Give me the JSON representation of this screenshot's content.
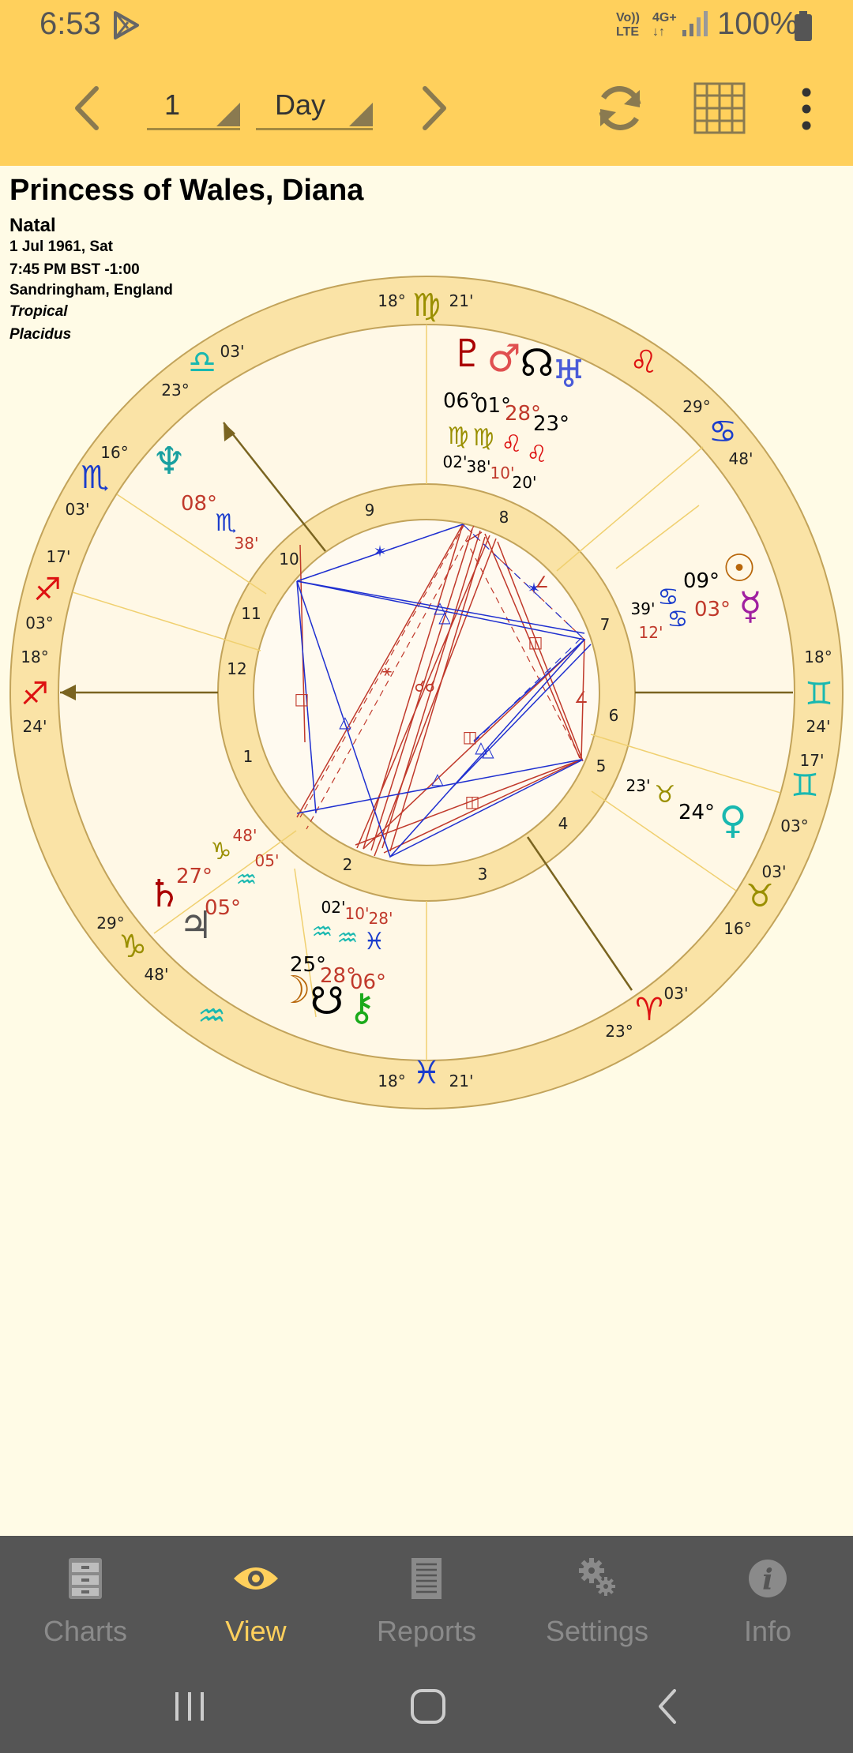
{
  "status": {
    "time": "6:53",
    "net_top": "Vo))",
    "net_bottom": "LTE",
    "net2_top": "4G+",
    "net2_bottom": "↓↑",
    "battery": "100%"
  },
  "toolbar": {
    "step_value": "1",
    "unit_value": "Day"
  },
  "chart": {
    "name": "Princess of Wales, Diana",
    "type": "Natal",
    "date": "1 Jul 1961, Sat",
    "time": "7:45 PM BST -1:00",
    "place": "Sandringham, England",
    "zodiac": "Tropical",
    "houses": "Placidus"
  },
  "wheel": {
    "outer_signs": [
      {
        "sign": "♍",
        "deg": "18°",
        "min": "21'",
        "color": "#9a8f00"
      },
      {
        "sign": "♌",
        "color": "#d11"
      },
      {
        "sign": "♋",
        "deg": "29°",
        "min": "48'",
        "color": "#1a3ccc"
      },
      {
        "sign": "♊",
        "deg": "18°",
        "min": "24'",
        "color": "#19b8b0"
      },
      {
        "sign": "♊",
        "deg": "17'",
        "min": "03°",
        "color": "#19b8b0"
      },
      {
        "sign": "♉",
        "deg": "03'",
        "min": "16°",
        "color": "#9a8f00"
      },
      {
        "sign": "♈",
        "deg": "03'",
        "min": "23°",
        "color": "#d11"
      },
      {
        "sign": "♓",
        "deg": "18°",
        "min": "21'",
        "color": "#1a3ccc"
      },
      {
        "sign": "♒",
        "color": "#19b8b0"
      },
      {
        "sign": "♑",
        "deg": "29°",
        "min": "48'",
        "color": "#9a8f00"
      },
      {
        "sign": "♐",
        "deg": "18°",
        "min": "24'",
        "color": "#d11"
      },
      {
        "sign": "♐",
        "deg": "17'",
        "min": "03°",
        "color": "#d11"
      },
      {
        "sign": "♏",
        "deg": "03'",
        "min": "16°",
        "color": "#1a3ccc"
      },
      {
        "sign": "♎",
        "deg": "03'",
        "min": "23°",
        "color": "#19b8b0"
      }
    ],
    "house_numbers": [
      "1",
      "2",
      "3",
      "4",
      "5",
      "6",
      "7",
      "8",
      "9",
      "10",
      "11",
      "12"
    ],
    "planets": [
      {
        "glyph": "♇",
        "deg": "06°",
        "min": "02'",
        "sign": "♍",
        "color": "#a00"
      },
      {
        "glyph": "♂",
        "deg": "01°",
        "min": "38'",
        "sign": "♍",
        "color": "#e05050"
      },
      {
        "glyph": "☊",
        "deg": "28°",
        "min": "10'",
        "sign": "♌",
        "color": "#000"
      },
      {
        "glyph": "♅",
        "deg": "23°",
        "min": "20'",
        "sign": "♌",
        "color": "#4a5bd8"
      },
      {
        "glyph": "☉",
        "deg": "09°",
        "min": "39'",
        "sign": "♋",
        "color": "#b8660a"
      },
      {
        "glyph": "☿",
        "deg": "03°",
        "min": "12'",
        "sign": "♋",
        "color": "#a020a0"
      },
      {
        "glyph": "♀",
        "deg": "24°",
        "min": "23'",
        "sign": "♉",
        "color": "#19b8b0"
      },
      {
        "glyph": "☽",
        "deg": "25°",
        "min": "02'",
        "sign": "♒",
        "color": "#b8660a"
      },
      {
        "glyph": "☋",
        "deg": "28°",
        "min": "10'",
        "sign": "♒",
        "color": "#000"
      },
      {
        "glyph": "⚷",
        "deg": "06°",
        "min": "28'",
        "sign": "♓",
        "color": "#1aaa1a"
      },
      {
        "glyph": "♄",
        "deg": "27°",
        "min": "48'",
        "sign": "♑",
        "color": "#a00"
      },
      {
        "glyph": "♃",
        "deg": "05°",
        "min": "05'",
        "sign": "♒",
        "color": "#555"
      },
      {
        "glyph": "♆",
        "deg": "08°",
        "min": "38'",
        "sign": "♏",
        "color": "#19a0a0"
      }
    ]
  },
  "nav": {
    "items": [
      {
        "label": "Charts"
      },
      {
        "label": "View"
      },
      {
        "label": "Reports"
      },
      {
        "label": "Settings"
      },
      {
        "label": "Info"
      }
    ]
  },
  "colors": {
    "bar": "#ffd05c",
    "ring": "#fae3a6",
    "line": "#8a7020",
    "accent": "#ffd05c"
  }
}
